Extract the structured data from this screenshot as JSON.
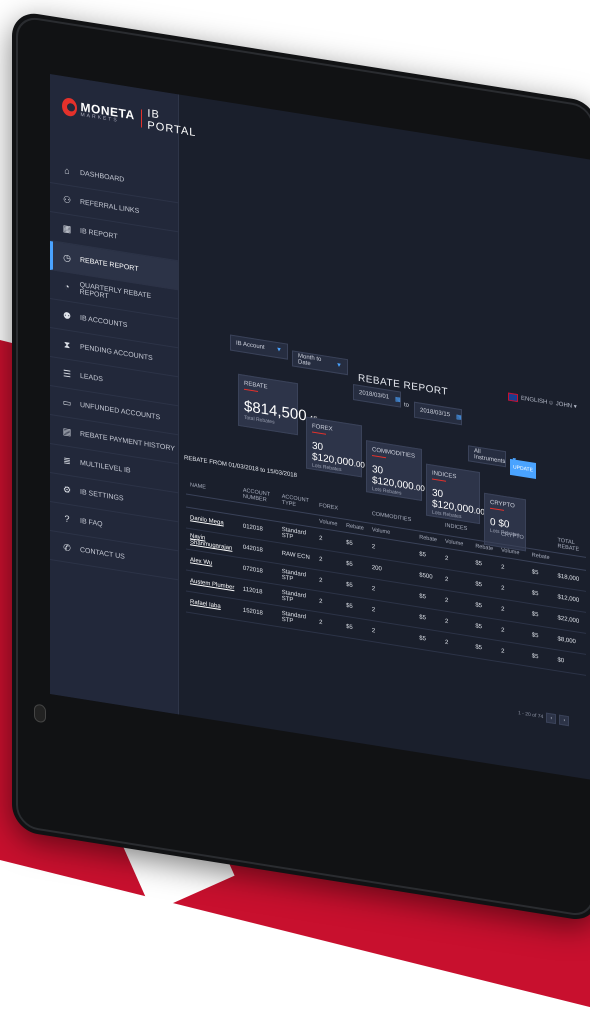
{
  "brand": {
    "name": "MONETA",
    "sub": "MARKETS",
    "portal": "IB PORTAL"
  },
  "sidebar": {
    "items": [
      {
        "label": "DASHBOARD",
        "icon": "home-icon",
        "glyph": "⌂"
      },
      {
        "label": "REFERRAL LINKS",
        "icon": "users-icon",
        "glyph": "⚇"
      },
      {
        "label": "IB REPORT",
        "icon": "report-icon",
        "glyph": "▦"
      },
      {
        "label": "REBATE REPORT",
        "icon": "rebate-icon",
        "glyph": "◷",
        "active": true
      },
      {
        "label": "QUARTERLY REBATE REPORT",
        "icon": "pie-icon",
        "glyph": "◔"
      },
      {
        "label": "IB ACCOUNTS",
        "icon": "accounts-icon",
        "glyph": "⚉"
      },
      {
        "label": "PENDING ACCOUNTS",
        "icon": "hourglass-icon",
        "glyph": "⧗"
      },
      {
        "label": "LEADS",
        "icon": "leads-icon",
        "glyph": "☰"
      },
      {
        "label": "UNFUNDED ACCOUNTS",
        "icon": "card-icon",
        "glyph": "▭"
      },
      {
        "label": "REBATE PAYMENT HISTORY",
        "icon": "history-icon",
        "glyph": "▤"
      },
      {
        "label": "MULTILEVEL IB",
        "icon": "stack-icon",
        "glyph": "≣"
      },
      {
        "label": "IB SETTINGS",
        "icon": "gear-icon",
        "glyph": "⚙"
      },
      {
        "label": "IB FAQ",
        "icon": "faq-icon",
        "glyph": "?"
      },
      {
        "label": "CONTACT US",
        "icon": "phone-icon",
        "glyph": "✆"
      }
    ]
  },
  "header": {
    "title": "REBATE REPORT",
    "language": "ENGLISH",
    "user": "JOHN"
  },
  "filters": {
    "account": "IB Account",
    "period": "Month to Date",
    "date_from": "2018/03/01",
    "to_label": "to",
    "date_to": "2018/03/15",
    "instruments": "All Instruments",
    "update": "UPDATE"
  },
  "cards": {
    "rebate": {
      "title": "REBATE",
      "amount": "$814,500",
      "cents": ".45",
      "sub": "Total Rebates"
    },
    "forex": {
      "title": "FOREX",
      "lots": "30",
      "amount": "$120,000",
      "cents": ".00",
      "lots_label": "Lots",
      "rebates_label": "Rebates"
    },
    "commodities": {
      "title": "COMMODITIES",
      "lots": "30",
      "amount": "$120,000",
      "cents": ".00",
      "lots_label": "Lots",
      "rebates_label": "Rebates"
    },
    "indices": {
      "title": "INDICES",
      "lots": "30",
      "amount": "$120,000",
      "cents": ".00",
      "lots_label": "Lots",
      "rebates_label": "Rebates"
    },
    "crypto": {
      "title": "CRYPTO",
      "lots": "0",
      "amount": "$0",
      "cents": "",
      "lots_label": "Lots",
      "rebates_label": "Rebates"
    }
  },
  "range_label": "REBATE FROM 01/03/2018 to 15/03/2018",
  "table": {
    "headers": [
      "NAME",
      "ACCOUNT NUMBER",
      "ACCOUNT TYPE",
      "FOREX",
      "",
      "COMMODITIES",
      "",
      "INDICES",
      "",
      "CRYPTO",
      "",
      "TOTAL REBATE"
    ],
    "subheaders": [
      "",
      "",
      "",
      "Volume",
      "Rebate",
      "Volume",
      "Rebate",
      "Volume",
      "Rebate",
      "Volume",
      "Rebate",
      ""
    ],
    "rows": [
      [
        "Danilo Mega",
        "012018",
        "Standard STP",
        "2",
        "$5",
        "2",
        "$5",
        "2",
        "$5",
        "2",
        "$5",
        "$18,000"
      ],
      [
        "Nayin Shanmugarajan",
        "042018",
        "RAW ECN",
        "2",
        "$5",
        "200",
        "$500",
        "2",
        "$5",
        "2",
        "$5",
        "$12,000"
      ],
      [
        "Alex Wu",
        "072018",
        "Standard STP",
        "2",
        "$5",
        "2",
        "$5",
        "2",
        "$5",
        "2",
        "$5",
        "$22,000"
      ],
      [
        "Austem Plumber",
        "112018",
        "Standard STP",
        "2",
        "$5",
        "2",
        "$5",
        "2",
        "$5",
        "2",
        "$5",
        "$8,000"
      ],
      [
        "Rafael Iaba",
        "152018",
        "Standard STP",
        "2",
        "$5",
        "2",
        "$5",
        "2",
        "$5",
        "2",
        "$5",
        "$0"
      ]
    ]
  },
  "pager": {
    "text": "1 - 20 of 74"
  }
}
